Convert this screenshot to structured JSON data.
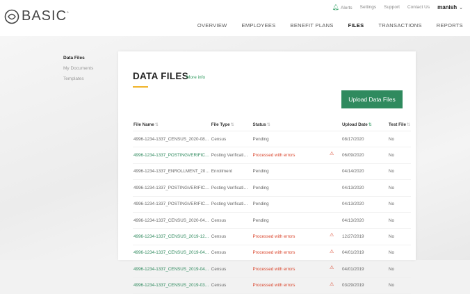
{
  "header": {
    "logo_text": "BASIC",
    "logo_mark": "°",
    "util_links": [
      "Alerts",
      "Settings",
      "Support",
      "Contact Us"
    ],
    "user_name": "manish",
    "nav": [
      "OVERVIEW",
      "EMPLOYEES",
      "BENEFIT PLANS",
      "FILES",
      "TRANSACTIONS",
      "REPORTS"
    ],
    "active_nav": "FILES"
  },
  "sidebar": {
    "items": [
      {
        "label": "Data Files"
      },
      {
        "label": "My Documents"
      },
      {
        "label": "Templates"
      }
    ]
  },
  "main": {
    "title": "DATA FILES",
    "more_info": "More info",
    "upload_button": "Upload Data Files",
    "columns": [
      "File Name",
      "File Type",
      "Status",
      "Upload Date",
      "Test File"
    ],
    "rows": [
      {
        "name": "4996-1234-1337_CENSUS_2020-08-1…",
        "type": "Census",
        "status": "Pending",
        "date": "08/17/2020",
        "test": "No",
        "error": false
      },
      {
        "name": "4996-1234-1337_POSTINGVERIFICA…",
        "type": "Posting Verificati…",
        "status": "Processed with errors",
        "date": "06/09/2020",
        "test": "No",
        "error": true
      },
      {
        "name": "4996-1234-1337_ENROLLMENT_202…",
        "type": "Enrollment",
        "status": "Pending",
        "date": "04/14/2020",
        "test": "No",
        "error": false
      },
      {
        "name": "4996-1234-1337_POSTINGVERIFICA…",
        "type": "Posting Verificati…",
        "status": "Pending",
        "date": "04/13/2020",
        "test": "No",
        "error": false
      },
      {
        "name": "4996-1234-1337_POSTINGVERIFICA…",
        "type": "Posting Verificati…",
        "status": "Pending",
        "date": "04/13/2020",
        "test": "No",
        "error": false
      },
      {
        "name": "4996-1234-1337_CENSUS_2020-04-1…",
        "type": "Census",
        "status": "Pending",
        "date": "04/13/2020",
        "test": "No",
        "error": false
      },
      {
        "name": "4996-1234-1337_CENSUS_2019-12-…",
        "type": "Census",
        "status": "Processed with errors",
        "date": "12/27/2019",
        "test": "No",
        "error": true
      },
      {
        "name": "4996-1234-1337_CENSUS_2019-04-…",
        "type": "Census",
        "status": "Processed with errors",
        "date": "04/01/2019",
        "test": "No",
        "error": true
      },
      {
        "name": "4996-1234-1337_CENSUS_2019-04-…",
        "type": "Census",
        "status": "Processed with errors",
        "date": "04/01/2019",
        "test": "No",
        "error": true
      },
      {
        "name": "4996-1234-1337_CENSUS_2019-03-…",
        "type": "Census",
        "status": "Processed with errors",
        "date": "03/29/2019",
        "test": "No",
        "error": true
      }
    ]
  },
  "colors": {
    "accent": "#2f8a5e",
    "error": "#d9442b",
    "underline": "#f0b429"
  },
  "icons": {
    "alerts": "bell-icon",
    "user_menu": "chevron-down-icon",
    "warning": "warning-icon",
    "sort": "sort-icon"
  }
}
